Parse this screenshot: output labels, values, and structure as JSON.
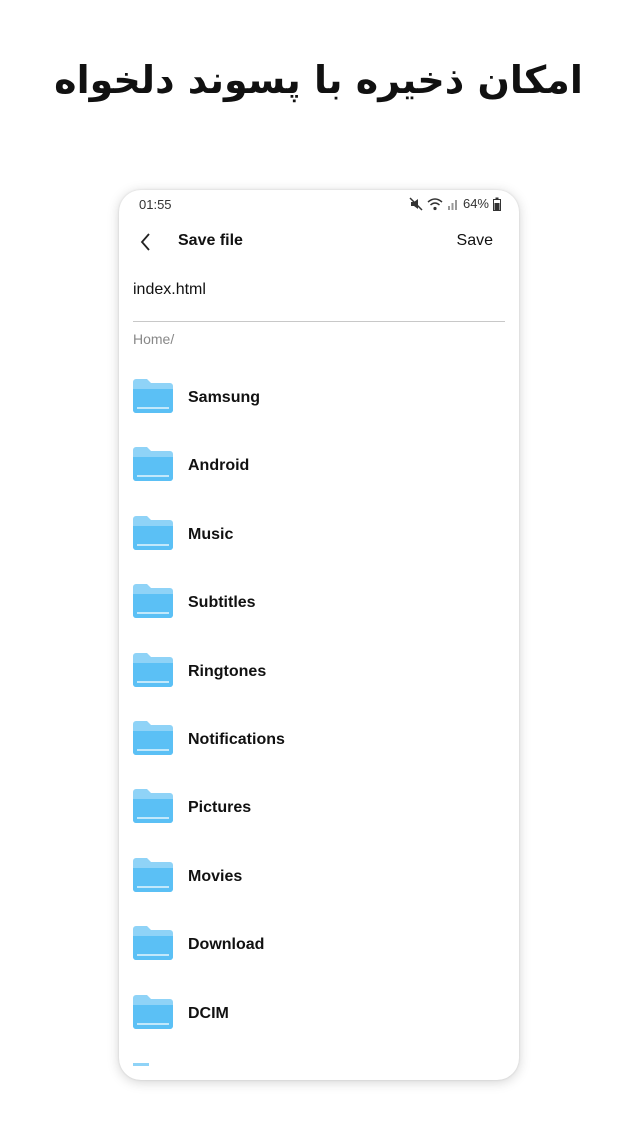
{
  "headline": "امکان ذخیره با پسوند دلخواه",
  "status_bar": {
    "time": "01:55",
    "battery": "64%",
    "icons": [
      "mute-icon",
      "wifi-icon",
      "signal-icon",
      "battery-icon"
    ]
  },
  "app_bar": {
    "title": "Save file",
    "save_label": "Save"
  },
  "filename_input": {
    "value": "index.html"
  },
  "breadcrumb": "Home/",
  "folders": [
    {
      "label": "Samsung"
    },
    {
      "label": "Android"
    },
    {
      "label": "Music"
    },
    {
      "label": "Subtitles"
    },
    {
      "label": "Ringtones"
    },
    {
      "label": "Notifications"
    },
    {
      "label": "Pictures"
    },
    {
      "label": "Movies"
    },
    {
      "label": "Download"
    },
    {
      "label": "DCIM"
    }
  ],
  "colors": {
    "folder_back": "#8fd3f7",
    "folder_front": "#5bc0f5",
    "folder_line": "#ffffff"
  }
}
